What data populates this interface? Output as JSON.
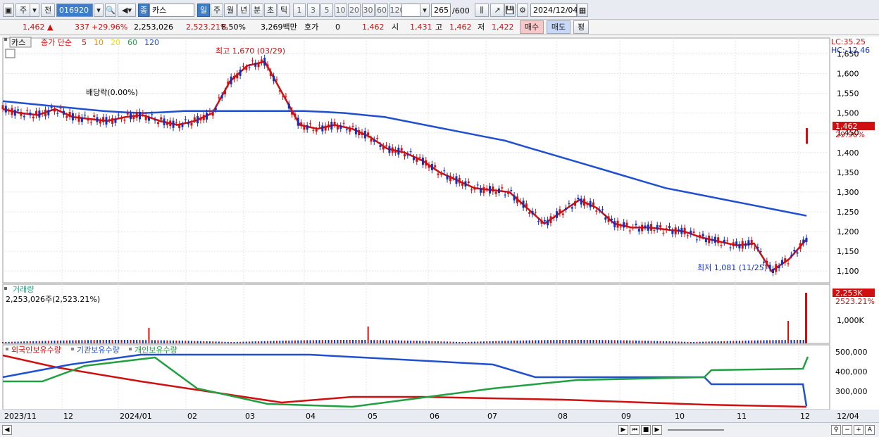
{
  "toolbar": {
    "type_label": "주",
    "prev_label": "전",
    "code": "016920",
    "stock_name": "카스",
    "stock_badge": "종",
    "periods": [
      "일",
      "주",
      "월",
      "년",
      "분",
      "초",
      "틱"
    ],
    "intervals": [
      "1",
      "3",
      "5",
      "10",
      "20",
      "30",
      "60",
      "120"
    ],
    "count": "265",
    "count_total": "/600",
    "date": "2024/12/04"
  },
  "quote": {
    "price": "1,462",
    "change": "337",
    "change_pct": "+29.96%",
    "volume": "2,253,026",
    "volume_pct": "2,523.21%",
    "turnover_pct": "8.50%",
    "amount": "3,269백만",
    "hoga_label": "호가",
    "hoga_value": "0",
    "hoga_price": "1,462",
    "open_label": "시",
    "open": "1,431",
    "high_label": "고",
    "high": "1,462",
    "low_label": "저",
    "low": "1,422",
    "buy_label": "매수",
    "sell_label": "매도",
    "eval_label": "평"
  },
  "price_panel": {
    "name_tag": "카스",
    "legend_title": "종가 단순",
    "ma_periods": [
      "5",
      "10",
      "20",
      "60",
      "120"
    ],
    "ma_colors": [
      "#d01010",
      "#f08a10",
      "#f0e000",
      "#20a040",
      "#2050d0"
    ],
    "high_annotation": "최고 1,670 (03/29)",
    "low_annotation": "최저 1,081 (11/25)",
    "dividend_annotation": "배당락(0.00%)",
    "lc": "LC:35.25",
    "hc": "HC:-12.46",
    "last_price_tag": "1,462",
    "last_pct_tag": "29.96%",
    "y_ticks": [
      "1,650",
      "1,600",
      "1,550",
      "1,500",
      "1,450",
      "1,400",
      "1,350",
      "1,300",
      "1,250",
      "1,200",
      "1,150",
      "1,100"
    ]
  },
  "volume_panel": {
    "title": "거래량",
    "value": "2,253,026주(2,523.21%)",
    "tag_value": "2,253K",
    "tag_pct": "2523.21%",
    "y_tick": "1,000K"
  },
  "holding_panel": {
    "series": [
      "외국인보유수량",
      "기관보유수량",
      "개인보유수량"
    ],
    "series_colors": [
      "#d01010",
      "#2050d0",
      "#20a040"
    ],
    "y_ticks": [
      "500,000",
      "400,000",
      "300,000"
    ]
  },
  "x_axis": [
    "2023/11",
    "12",
    "2024/01",
    "02",
    "03",
    "04",
    "05",
    "06",
    "07",
    "08",
    "09",
    "10",
    "11",
    "12",
    "12/04"
  ],
  "chart_data": {
    "type": "line",
    "title": "",
    "y_range": [
      1070,
      1690
    ],
    "series": [
      {
        "name": "5",
        "color": "#d01010",
        "values": [
          1510,
          1500,
          1495,
          1510,
          1490,
          1485,
          1480,
          1490,
          1495,
          1480,
          1470,
          1480,
          1500,
          1580,
          1620,
          1630,
          1550,
          1470,
          1460,
          1470,
          1460,
          1440,
          1410,
          1400,
          1380,
          1350,
          1330,
          1310,
          1305,
          1300,
          1260,
          1220,
          1250,
          1280,
          1260,
          1220,
          1210,
          1210,
          1205,
          1200,
          1185,
          1175,
          1165,
          1170,
          1100,
          1130,
          1180
        ]
      },
      {
        "name": "120",
        "color": "#2050d0",
        "values": [
          1530,
          1525,
          1520,
          1515,
          1510,
          1505,
          1502,
          1500,
          1502,
          1505,
          1505,
          1505,
          1505,
          1505,
          1505,
          1505,
          1503,
          1500,
          1495,
          1490,
          1480,
          1470,
          1460,
          1450,
          1440,
          1430,
          1415,
          1400,
          1385,
          1370,
          1355,
          1340,
          1325,
          1310,
          1300,
          1290,
          1280,
          1270,
          1260,
          1250,
          1240
        ]
      }
    ]
  }
}
